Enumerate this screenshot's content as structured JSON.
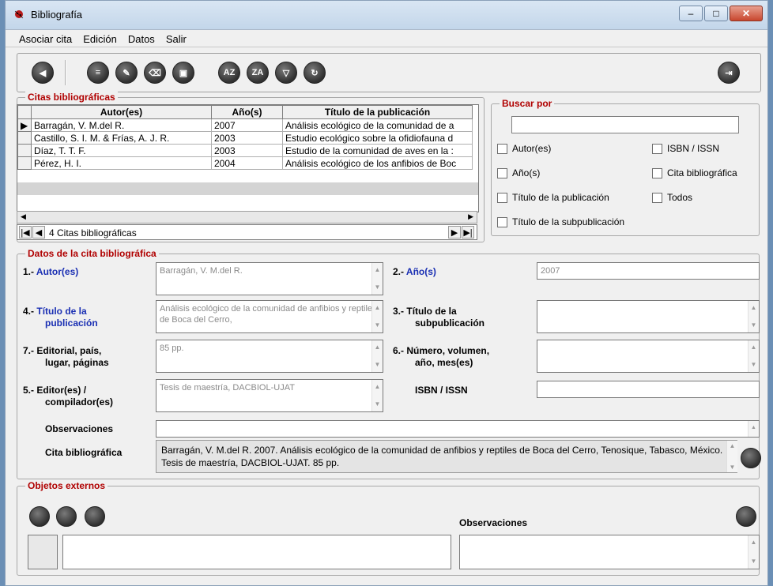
{
  "window": {
    "title": "Bibliografía"
  },
  "menu": [
    "Asociar cita",
    "Edición",
    "Datos",
    "Salir"
  ],
  "toolbar_icons": [
    "back-icon",
    "import-icon",
    "edit-icon",
    "erase-icon",
    "save-icon",
    "sort-az-icon",
    "sort-za-icon",
    "filter-icon",
    "refresh-icon",
    "exit-door-icon"
  ],
  "citas": {
    "legend": "Citas bibliográficas",
    "headers": [
      "Autor(es)",
      "Año(s)",
      "Título de la publicación"
    ],
    "rows": [
      [
        "Barragán, V. M.del R.",
        "2007",
        "Análisis ecológico de la comunidad de a"
      ],
      [
        "Castillo, S. I. M. & Frías, A. J. R.",
        "2003",
        "Estudio ecológico sobre la ofidiofauna d"
      ],
      [
        "Díaz, T. T. F.",
        "2003",
        "Estudio de la comunidad de aves en la :"
      ],
      [
        "Pérez, H. I.",
        "2004",
        "Análisis ecológico de los anfibios de Boc"
      ]
    ],
    "count_text": "4 Citas bibliográficas"
  },
  "buscar": {
    "legend": "Buscar por",
    "options": [
      "Autor(es)",
      "ISBN / ISSN",
      "Año(s)",
      "Cita bibliográfica",
      "Título de la publicación",
      "Todos",
      "Título de la subpublicación"
    ]
  },
  "datos": {
    "legend": "Datos de la cita bibliográfica",
    "autor": {
      "num": "1.-",
      "label": "Autor(es)",
      "value": "Barragán, V. M.del R."
    },
    "anio": {
      "num": "2.-",
      "label": "Año(s)",
      "value": "2007"
    },
    "titulo": {
      "num": "4.-",
      "label1": "Título de la",
      "label2": "publicación",
      "value": "Análisis ecológico de la comunidad de anfibios y reptiles de Boca del Cerro,"
    },
    "subpub": {
      "num": "3.-",
      "label1": "Título de la",
      "label2": "subpublicación",
      "value": ""
    },
    "editorial": {
      "num": "7.-",
      "label1": "Editorial, país,",
      "label2": "lugar, páginas",
      "value": "85 pp."
    },
    "numero": {
      "num": "6.-",
      "label1": "Número, volumen,",
      "label2": "año, mes(es)",
      "value": ""
    },
    "editor": {
      "num": "5.-",
      "label1": "Editor(es) /",
      "label2": "compilador(es)",
      "value": "Tesis de maestría, DACBIOL-UJAT"
    },
    "isbn": {
      "label": "ISBN / ISSN",
      "value": ""
    },
    "observaciones": {
      "label": "Observaciones",
      "value": ""
    },
    "cita": {
      "label": "Cita bibliográfica",
      "value": "Barragán, V. M.del R. 2007. Análisis ecológico de la comunidad de anfibios y reptiles de Boca del Cerro, Tenosique, Tabasco, México. Tesis de maestría, DACBIOL-UJAT. 85 pp."
    }
  },
  "objetos": {
    "legend": "Objetos externos",
    "observaciones_label": "Observaciones"
  }
}
